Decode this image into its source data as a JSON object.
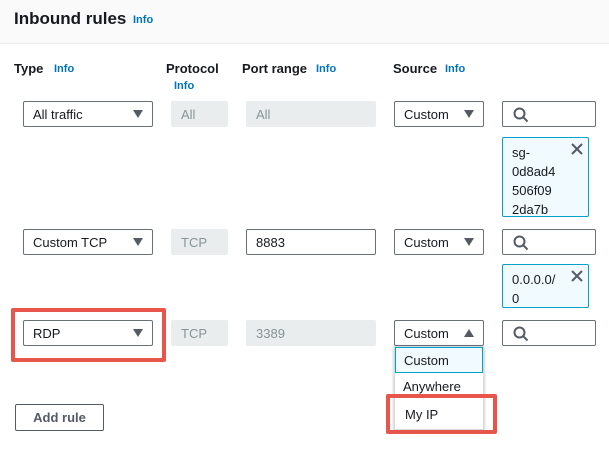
{
  "section": {
    "title": "Inbound rules",
    "info": "Info"
  },
  "columns": {
    "type": {
      "label": "Type",
      "info": "Info"
    },
    "protocol": {
      "label": "Protocol",
      "info": "Info"
    },
    "port_range": {
      "label": "Port range",
      "info": "Info"
    },
    "source": {
      "label": "Source",
      "info": "Info"
    }
  },
  "rows": [
    {
      "type": "All traffic",
      "protocol": "All",
      "port_range": "All",
      "source": "Custom",
      "token": [
        "sg-",
        "0d8ad4",
        "506f09",
        "2da7b"
      ]
    },
    {
      "type": "Custom TCP",
      "protocol": "TCP",
      "port_range": "8883",
      "source": "Custom",
      "token": [
        "0.0.0.0/",
        "0"
      ]
    },
    {
      "type": "RDP",
      "protocol": "TCP",
      "port_range": "3389",
      "source": "Custom"
    }
  ],
  "source_dropdown": {
    "options": [
      "Custom",
      "Anywhere",
      "My IP"
    ],
    "selected": "Custom"
  },
  "add_rule_label": "Add rule",
  "colors": {
    "accent": "#0073bb",
    "highlight": "#e8554b",
    "token_border": "#00a1c9"
  }
}
